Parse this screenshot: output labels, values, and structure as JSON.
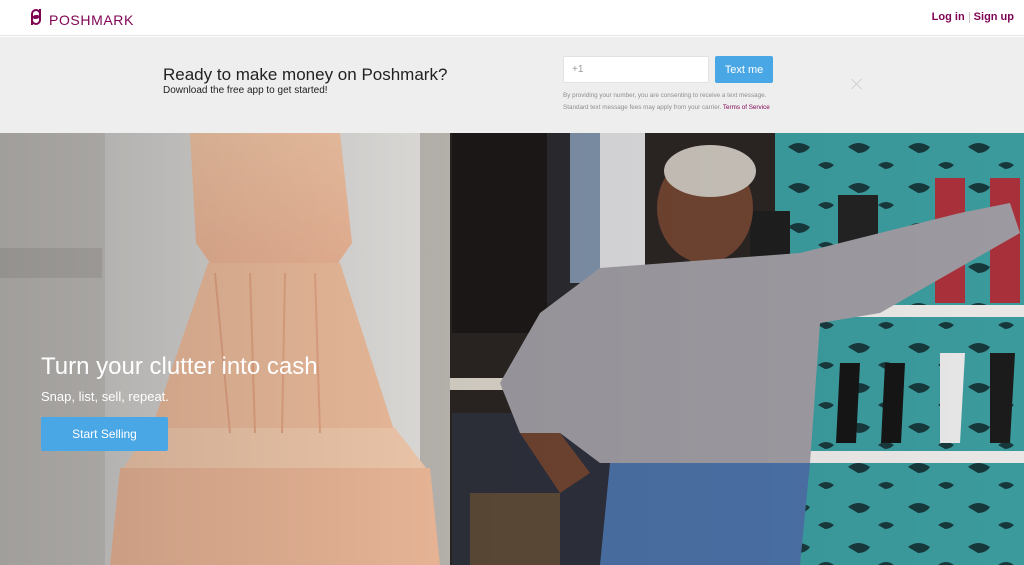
{
  "header": {
    "logo_text": "POSHMARK",
    "login_label": "Log in",
    "signup_label": "Sign up",
    "brand_color": "#7f0353"
  },
  "promo": {
    "title": "Ready to make money on Poshmark?",
    "subtitle": "Download the free app to get started!",
    "phone_placeholder": "+1",
    "text_me_label": "Text me",
    "disclaimer_line1": "By providing your number, you are consenting to receive a text message.",
    "disclaimer_line2": "Standard text message fees may apply from your carrier.",
    "terms_label": "Terms of Service",
    "button_color": "#4aa7e6"
  },
  "hero": {
    "title": "Turn your clutter into cash",
    "subtitle": "Snap, list, sell, repeat.",
    "cta_label": "Start Selling"
  }
}
